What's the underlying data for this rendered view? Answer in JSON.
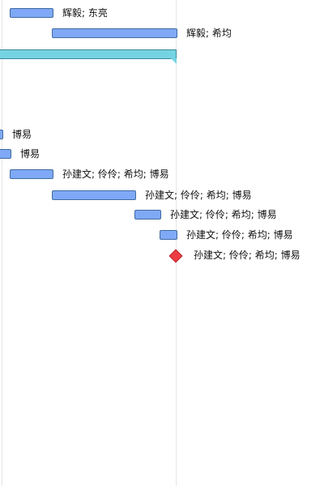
{
  "tasks": [
    {
      "resources": "辉毅; 东亮"
    },
    {
      "resources": "辉毅; 希均"
    },
    {
      "resources": "博易"
    },
    {
      "resources": "博易"
    },
    {
      "resources": "孙建文; 伶伶; 希均; 博易"
    },
    {
      "resources": "孙建文; 伶伶; 希均; 博易"
    },
    {
      "resources": "孙建文; 伶伶; 希均; 博易"
    },
    {
      "resources": "孙建文; 伶伶; 希均; 博易"
    },
    {
      "resources": "孙建文; 伶伶; 希均; 博易"
    }
  ],
  "colors": {
    "task": "#7fa9f7",
    "summary": "#74d3e2",
    "milestone": "#ee3c43"
  }
}
